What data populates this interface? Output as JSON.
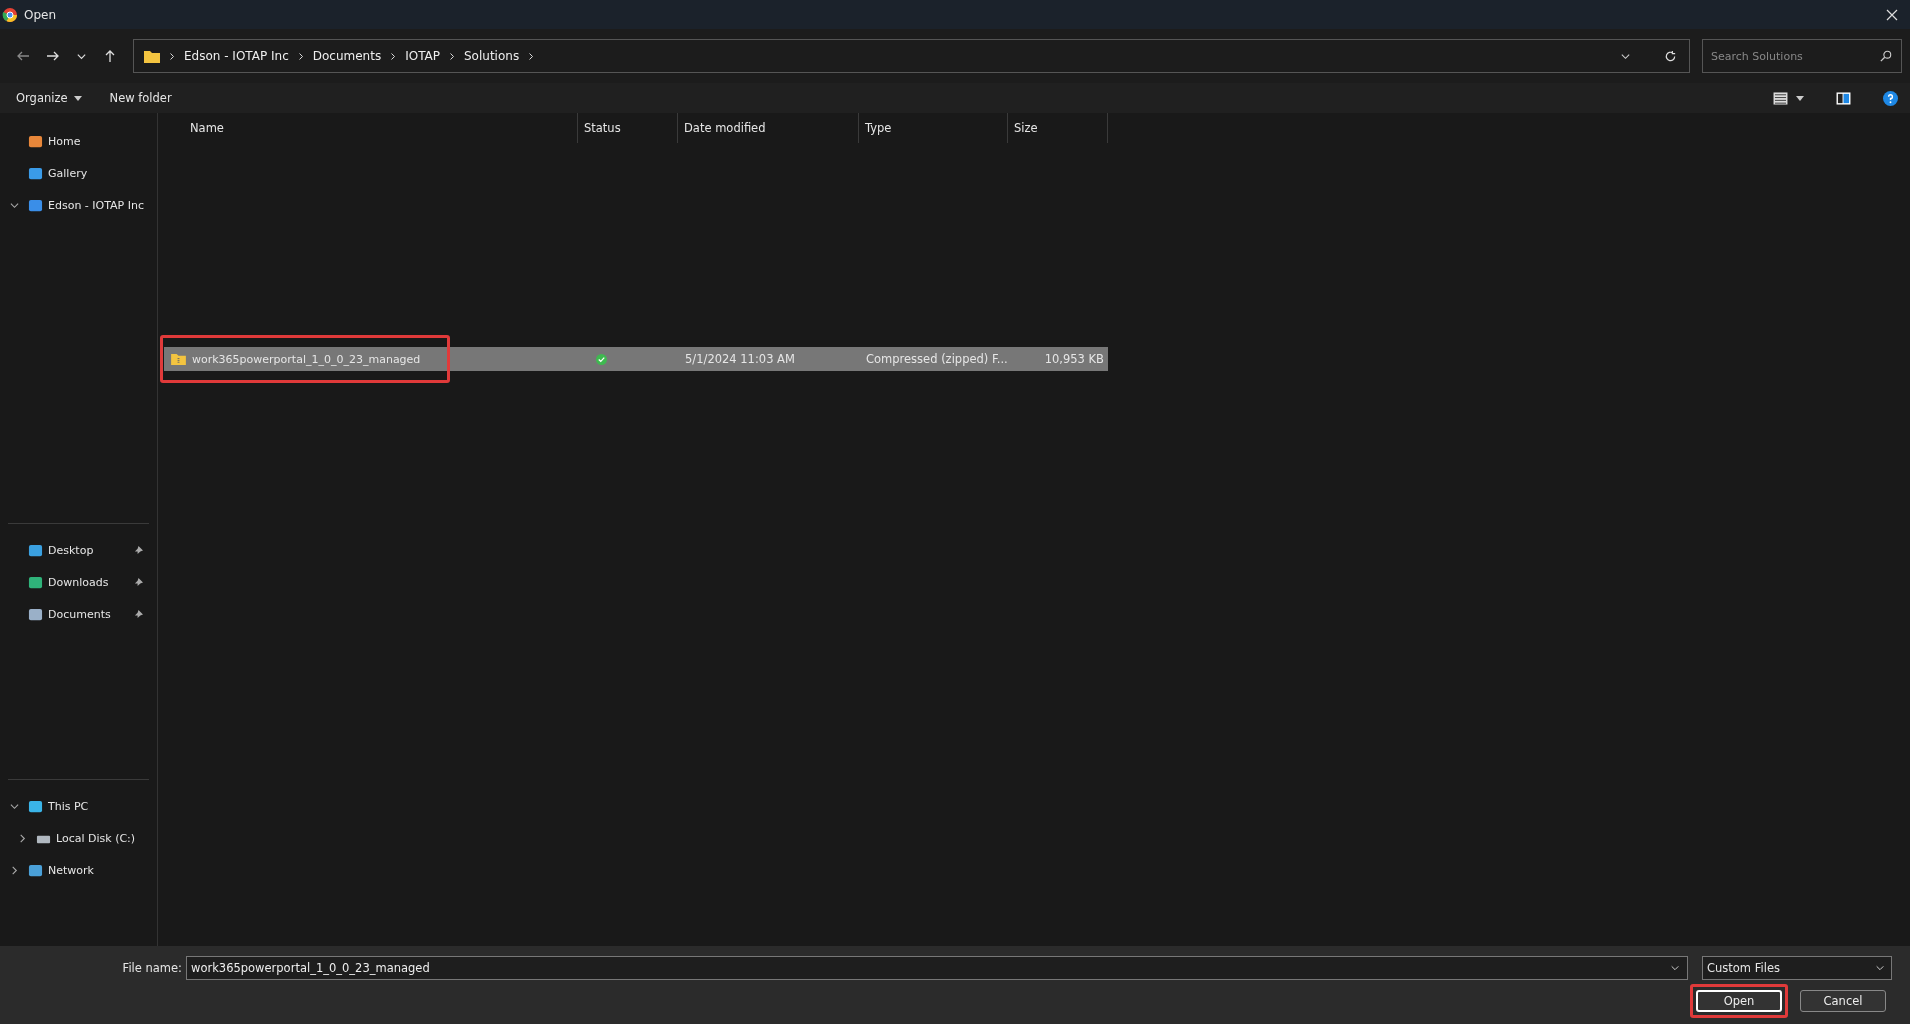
{
  "window": {
    "title": "Open"
  },
  "nav": {
    "path": [
      "Edson - IOTAP Inc",
      "Documents",
      "IOTAP",
      "Solutions"
    ],
    "search_placeholder": "Search Solutions"
  },
  "toolbar": {
    "organize": "Organize",
    "new_folder": "New folder"
  },
  "sidebar": {
    "groups": [
      [
        {
          "label": "Home"
        },
        {
          "label": "Gallery"
        },
        {
          "label": "Edson - IOTAP Inc",
          "expanded": true
        }
      ],
      [
        {
          "label": "Desktop",
          "pinned": true
        },
        {
          "label": "Downloads",
          "pinned": true
        },
        {
          "label": "Documents",
          "pinned": true
        }
      ],
      [
        {
          "label": "This PC",
          "expanded": true,
          "children": [
            {
              "label": "Local Disk (C:)",
              "expanded": false
            }
          ]
        },
        {
          "label": "Network",
          "expanded": false
        }
      ]
    ]
  },
  "table": {
    "columns": [
      "Name",
      "Status",
      "Date modified",
      "Type",
      "Size"
    ],
    "rows": [
      {
        "name": "work365powerportal_1_0_0_23_managed",
        "synced": true,
        "date": "5/1/2024 11:03 AM",
        "type": "Compressed (zipped) F...",
        "size": "10,953 KB",
        "selected": true,
        "highlighted": true
      }
    ]
  },
  "footer": {
    "file_name_label": "File name:",
    "file_name": "work365powerportal_1_0_0_23_managed",
    "file_type": "Custom Files",
    "buttons": [
      {
        "label": "Open",
        "kind": "primary",
        "highlighted": true
      },
      {
        "label": "Cancel",
        "kind": "secondary",
        "highlighted": false
      }
    ]
  }
}
